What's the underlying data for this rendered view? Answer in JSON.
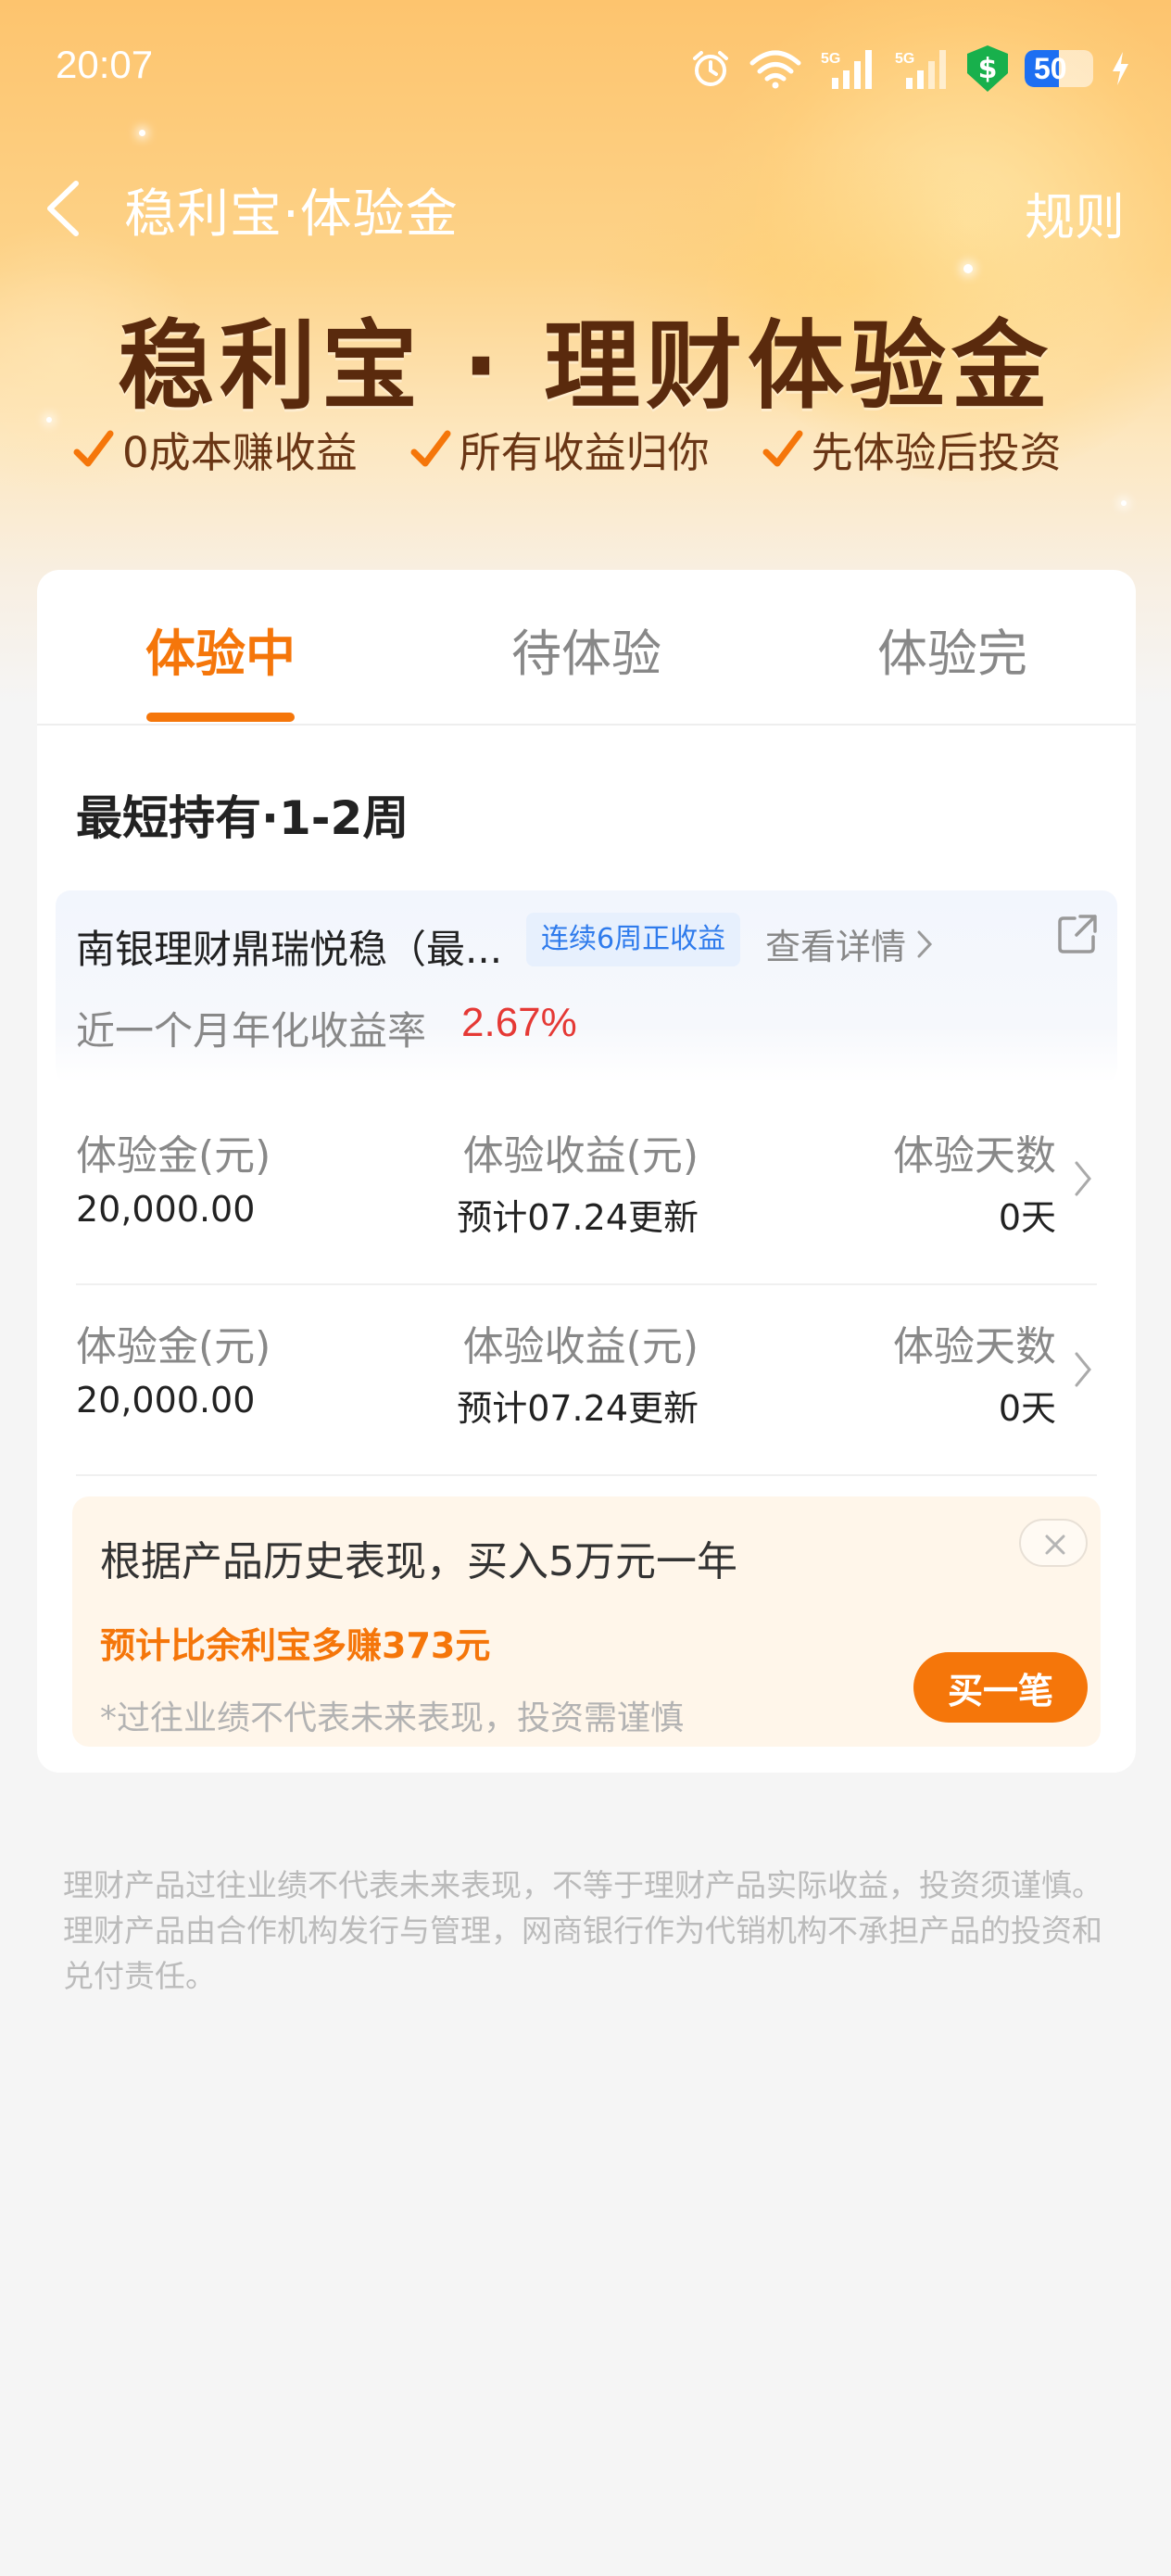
{
  "status_bar": {
    "time": "20:07",
    "signal_label_1": "5G",
    "signal_label_2": "5G",
    "battery": "50",
    "battery_level": 0.5,
    "icons": [
      "alarm-icon",
      "wifi-icon",
      "signal-5g-icon",
      "signal-5g-icon",
      "security-shield-icon",
      "battery-icon",
      "charging-icon"
    ],
    "shield_symbol": "$"
  },
  "nav": {
    "title": "稳利宝·体验金",
    "rules_label": "规则"
  },
  "hero": {
    "title": "稳利宝 · 理财体验金",
    "features": [
      "0成本赚收益",
      "所有收益归你",
      "先体验后投资"
    ]
  },
  "tabs": [
    {
      "label": "体验中",
      "active": true
    },
    {
      "label": "待体验",
      "active": false
    },
    {
      "label": "体验完",
      "active": false
    }
  ],
  "section_title": "最短持有·1-2周",
  "product": {
    "name": "南银理财鼎瑞悦稳（最...",
    "tag": "连续6周正收益",
    "detail_label": "查看详情",
    "rate_label": "近一个月年化收益率",
    "rate_value": "2.67%"
  },
  "experience_rows": [
    {
      "amount_label": "体验金(元)",
      "amount_value": "20,000.00",
      "income_label": "体验收益(元)",
      "income_value": "预计07.24更新",
      "days_label": "体验天数",
      "days_value": "0天"
    },
    {
      "amount_label": "体验金(元)",
      "amount_value": "20,000.00",
      "income_label": "体验收益(元)",
      "income_value": "预计07.24更新",
      "days_label": "体验天数",
      "days_value": "0天"
    }
  ],
  "promo": {
    "title": "根据产品历史表现，买入5万元一年",
    "highlight": "预计比余利宝多赚373元",
    "note": "*过往业绩不代表未来表现，投资需谨慎",
    "button_label": "买一笔"
  },
  "disclaimer": "理财产品过往业绩不代表未来表现，不等于理财产品实际收益，投资须谨慎。理财产品由合作机构发行与管理，网商银行作为代销机构不承担产品的投资和兑付责任。",
  "colors": {
    "accent": "#f5760a",
    "rate": "#e53935",
    "tag_blue": "#2f7bec",
    "hero_title": "#5a2a0d"
  }
}
